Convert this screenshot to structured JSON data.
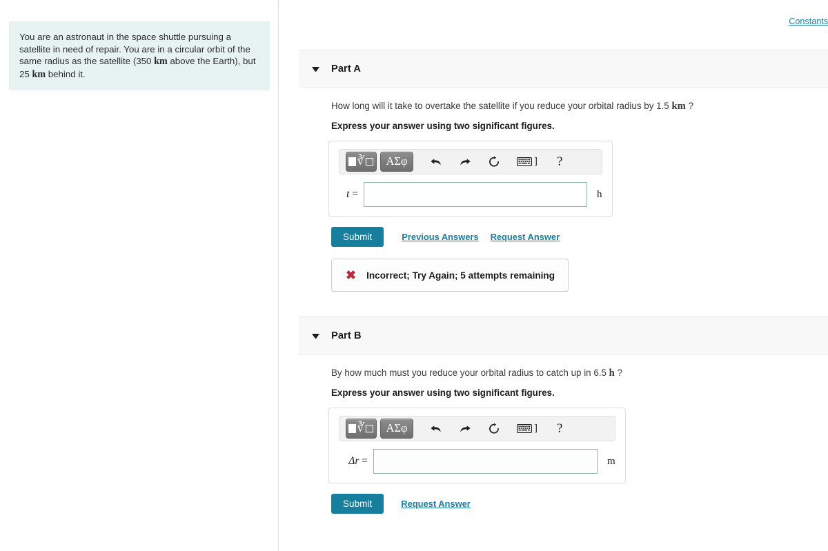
{
  "header": {
    "constants_link": "Constants"
  },
  "problem": {
    "text_segments": [
      {
        "t": "You are an astronaut in the space shuttle pursuing a satellite in need of repair. You are in a circular orbit of the same radius as the satellite (350 ",
        "unit": false
      },
      {
        "t": "km",
        "unit": true
      },
      {
        "t": " above the Earth), but 25 ",
        "unit": false
      },
      {
        "t": "km",
        "unit": true
      },
      {
        "t": " behind it.",
        "unit": false
      }
    ],
    "plain": "You are an astronaut in the space shuttle pursuing a satellite in need of repair. You are in a circular orbit of the same radius as the satellite (350 km above the Earth), but 25 km behind it."
  },
  "mathbar": {
    "template_button_label": "math-template",
    "greek_button_label": "ΑΣφ",
    "undo_label": "undo",
    "redo_label": "redo",
    "reset_label": "reset",
    "keyboard_label": "keyboard",
    "keyboard_bracket": "]",
    "help_label": "?"
  },
  "colors": {
    "submit_blue": "#177e9e",
    "link_blue": "#1a7fa0",
    "problem_box_bg": "#e7f2f3",
    "part_header_bg": "#f8f8f8",
    "error_red": "#c2283c",
    "input_border": "#8fb4b8"
  },
  "parts": [
    {
      "id": "part-a",
      "title": "Part A",
      "question_pre": "How long will it take to overtake the satellite if you reduce your orbital radius by 1.5 ",
      "question_unit": "km",
      "question_post": " ?",
      "instruction": "Express your answer using two significant figures.",
      "variable": "t",
      "operator": "=",
      "input_value": "",
      "input_placeholder": "",
      "unit": "h",
      "submit_label": "Submit",
      "links": [
        "Previous Answers",
        "Request Answer"
      ],
      "feedback": {
        "icon": "x-mark",
        "text": "Incorrect; Try Again; 5 attempts remaining"
      }
    },
    {
      "id": "part-b",
      "title": "Part B",
      "question_pre": "By how much must you reduce your orbital radius to catch up in 6.5 ",
      "question_unit": "h",
      "question_post": " ?",
      "instruction": "Express your answer using two significant figures.",
      "variable": "Δr",
      "operator": "=",
      "input_value": "",
      "input_placeholder": "",
      "unit": "m",
      "submit_label": "Submit",
      "links": [
        "Request Answer"
      ],
      "feedback": null
    }
  ]
}
